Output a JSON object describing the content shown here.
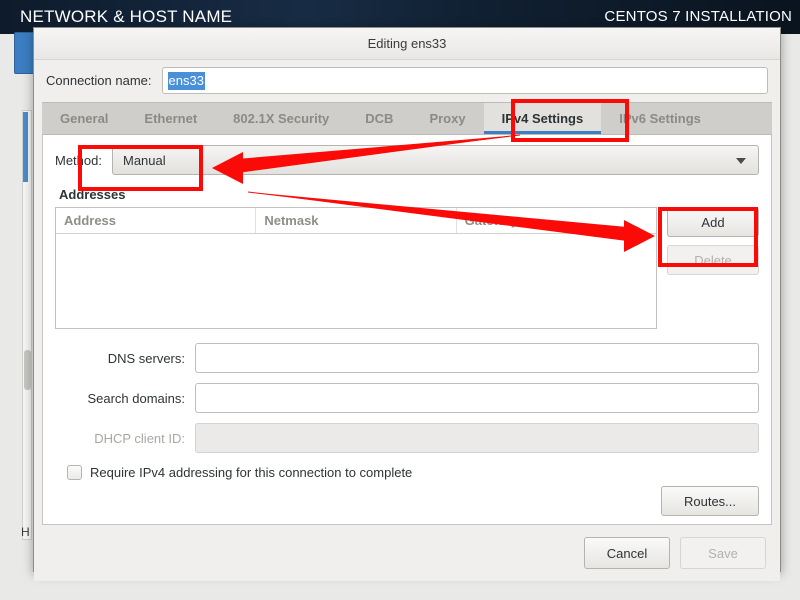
{
  "installer": {
    "header_title": "NETWORK & HOST NAME",
    "header_right": "CENTOS 7 INSTALLATION",
    "bg_partial_text": "H"
  },
  "dialog": {
    "title": "Editing ens33",
    "connection_name": {
      "label": "Connection name:",
      "value": "ens33",
      "selected": true,
      "selection_color": "#4a90d9"
    },
    "tabs": [
      {
        "label": "General",
        "active": false
      },
      {
        "label": "Ethernet",
        "active": false
      },
      {
        "label": "802.1X Security",
        "active": false
      },
      {
        "label": "DCB",
        "active": false
      },
      {
        "label": "Proxy",
        "active": false
      },
      {
        "label": "IPv4 Settings",
        "active": true
      },
      {
        "label": "IPv6 Settings",
        "active": false
      }
    ],
    "active_tab_accent": "#3f7fc1",
    "method": {
      "label": "Method:",
      "value": "Manual",
      "caret_icon": "chevron-down-icon"
    },
    "addresses": {
      "section_title": "Addresses",
      "columns": [
        "Address",
        "Netmask",
        "Gateway"
      ],
      "rows": [],
      "add_label": "Add",
      "delete_label": "Delete",
      "delete_disabled": true
    },
    "fields": [
      {
        "label": "DNS servers:",
        "value": "",
        "disabled": false
      },
      {
        "label": "Search domains:",
        "value": "",
        "disabled": false
      },
      {
        "label": "DHCP client ID:",
        "value": "",
        "disabled": true
      }
    ],
    "require_ipv4": {
      "label": "Require IPv4 addressing for this connection to complete",
      "checked": false
    },
    "routes_label": "Routes...",
    "footer": {
      "cancel_label": "Cancel",
      "save_label": "Save",
      "save_disabled": true
    }
  },
  "annotations": {
    "color": "#fb0b08",
    "highlighted": [
      "ipv4-settings-tab",
      "method-combo",
      "add-button"
    ],
    "arrows": [
      {
        "from": "ipv4-settings-tab",
        "to": "method-combo"
      },
      {
        "from": "method-combo",
        "to": "add-button"
      }
    ]
  }
}
